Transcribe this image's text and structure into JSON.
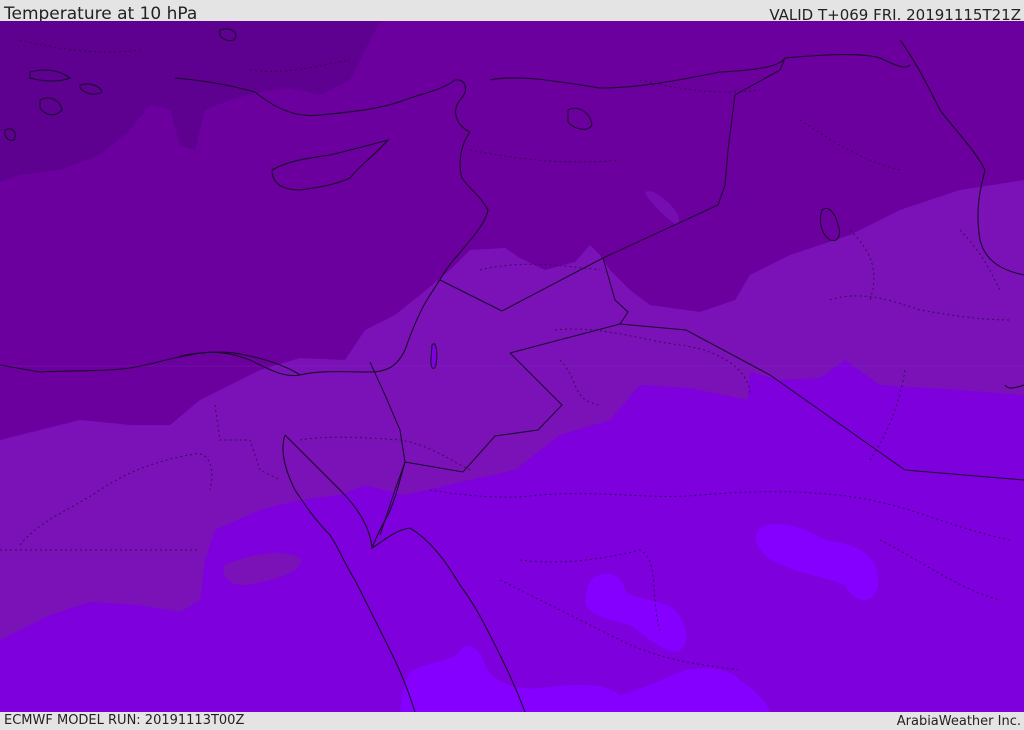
{
  "header": {
    "title": "Temperature at 10 hPa",
    "valid": "VALID T+069 FRI. 20191115T21Z"
  },
  "footer": {
    "model_run": "ECMWF MODEL RUN: 20191113T00Z",
    "credit": "ArabiaWeather Inc."
  },
  "map": {
    "colors": {
      "coldest": "#5e0090",
      "cold": "#6b009e",
      "mid": "#7a12b8",
      "warm": "#7d00dd",
      "warmest": "#8600ff",
      "coastline": "#1a0a2a"
    }
  }
}
